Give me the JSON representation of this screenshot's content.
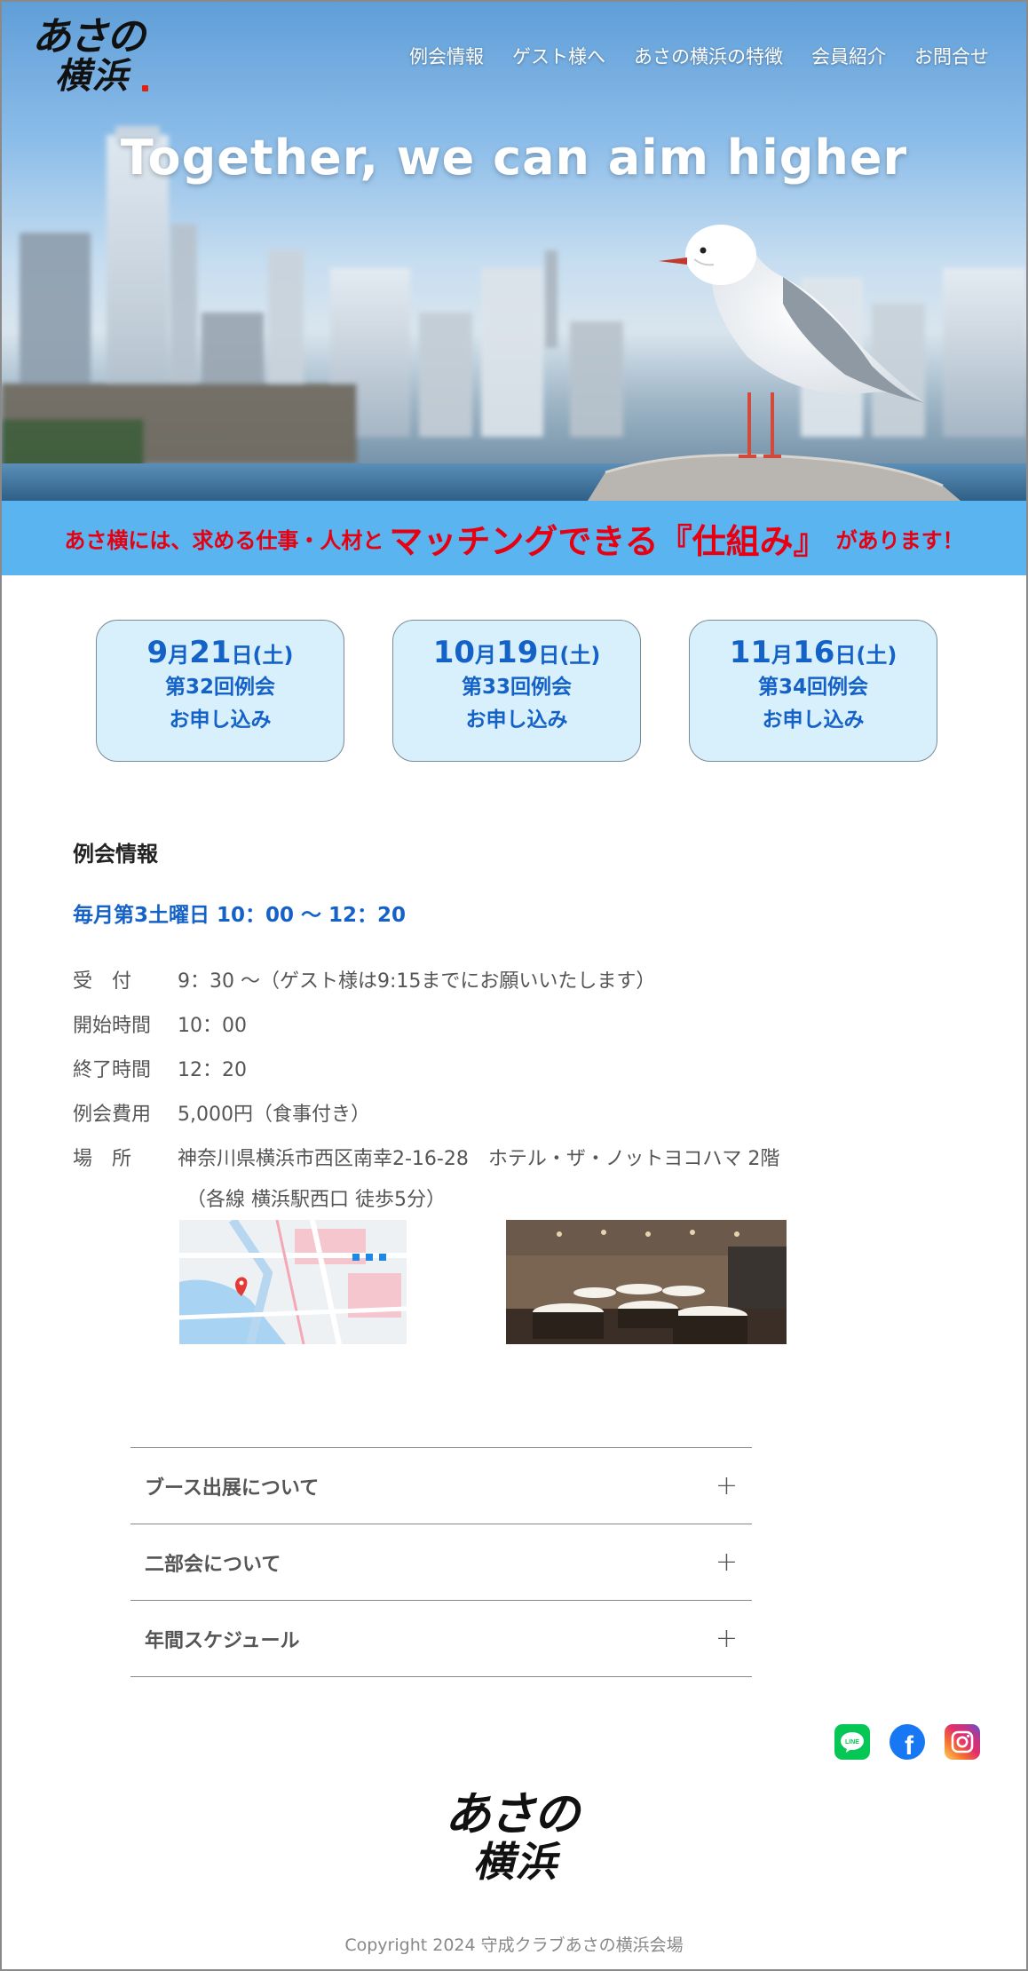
{
  "brand": {
    "logo_line1": "あさの",
    "logo_line2": "横浜"
  },
  "nav": [
    {
      "label": "例会情報"
    },
    {
      "label": "ゲスト様へ"
    },
    {
      "label": "あさの横浜の特徴"
    },
    {
      "label": "会員紹介"
    },
    {
      "label": "お問合せ"
    }
  ],
  "hero": {
    "tagline": "Together, we can aim higher"
  },
  "banner": {
    "part1": "あさ横には、求める仕事・人材と",
    "highlight": "マッチングできる『仕組み』",
    "part2": "があります！",
    "color": "#e60012",
    "background": "#5ab4ef"
  },
  "events": [
    {
      "month": "9",
      "month_unit": "月",
      "day": "21",
      "day_unit": "日(土)",
      "title": "第32回例会",
      "action": "お申し込み"
    },
    {
      "month": "10",
      "month_unit": "月",
      "day": "19",
      "day_unit": "日(土)",
      "title": "第33回例会",
      "action": "お申し込み"
    },
    {
      "month": "11",
      "month_unit": "月",
      "day": "16",
      "day_unit": "日(土)",
      "title": "第34回例会",
      "action": "お申し込み"
    }
  ],
  "info": {
    "heading": "例会情報",
    "schedule": "毎月第3土曜日 10：00 〜 12：20",
    "rows": [
      {
        "key": "受　付",
        "value": "9：30 〜（ゲスト様は9:15までにお願いいたします）"
      },
      {
        "key": "開始時間",
        "value": "10：00"
      },
      {
        "key": "終了時間",
        "value": "12：20"
      },
      {
        "key": "例会費用",
        "value": "5,000円（食事付き）"
      },
      {
        "key": "場　所",
        "value": "神奈川県横浜市西区南幸2-16-28　ホテル・ザ・ノットヨコハマ 2階"
      }
    ],
    "access_note": "（各線 横浜駅西口 徒歩5分）"
  },
  "accordion": [
    {
      "label": "ブース出展について",
      "icon": "plus-icon"
    },
    {
      "label": "二部会について",
      "icon": "plus-icon"
    },
    {
      "label": "年間スケジュール",
      "icon": "plus-icon"
    }
  ],
  "social": [
    {
      "name": "line-icon",
      "text": "LINE"
    },
    {
      "name": "facebook-icon",
      "text": "f"
    },
    {
      "name": "instagram-icon",
      "text": ""
    }
  ],
  "footer": {
    "copyright": "Copyright 2024 守成クラブあさの横浜会場"
  },
  "colors": {
    "accent_blue": "#1461c8",
    "event_bg": "#d8f0fc",
    "banner_text": "#e60012"
  }
}
